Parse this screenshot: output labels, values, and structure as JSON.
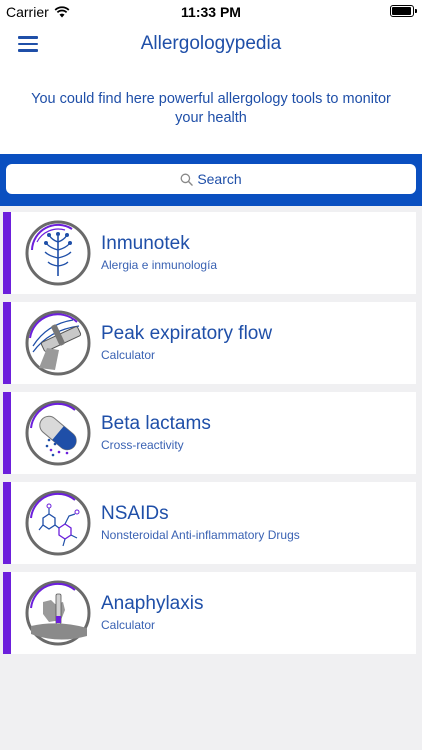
{
  "status_bar": {
    "carrier": "Carrier",
    "time": "11:33 PM"
  },
  "nav": {
    "title": "Allergologypedia",
    "menu_icon": "hamburger-menu-icon"
  },
  "intro": {
    "text": "You could find here powerful allergology tools to monitor your health"
  },
  "search": {
    "label": "Search",
    "icon": "search-icon"
  },
  "colors": {
    "accent": "#6c1fdc",
    "brand_blue": "#1f4fa8",
    "search_band": "#0a4fc0"
  },
  "items": [
    {
      "title": "Inmunotek",
      "subtitle": "Alergia e inmunología",
      "icon": "plant-icon"
    },
    {
      "title": "Peak expiratory flow",
      "subtitle": "Calculator",
      "icon": "peak-flow-meter-icon"
    },
    {
      "title": "Beta lactams",
      "subtitle": "Cross-reactivity",
      "icon": "capsule-icon"
    },
    {
      "title": "NSAIDs",
      "subtitle": "Nonsteroidal Anti-inflammatory Drugs",
      "icon": "molecule-icon"
    },
    {
      "title": "Anaphylaxis",
      "subtitle": "Calculator",
      "icon": "auto-injector-icon"
    }
  ]
}
